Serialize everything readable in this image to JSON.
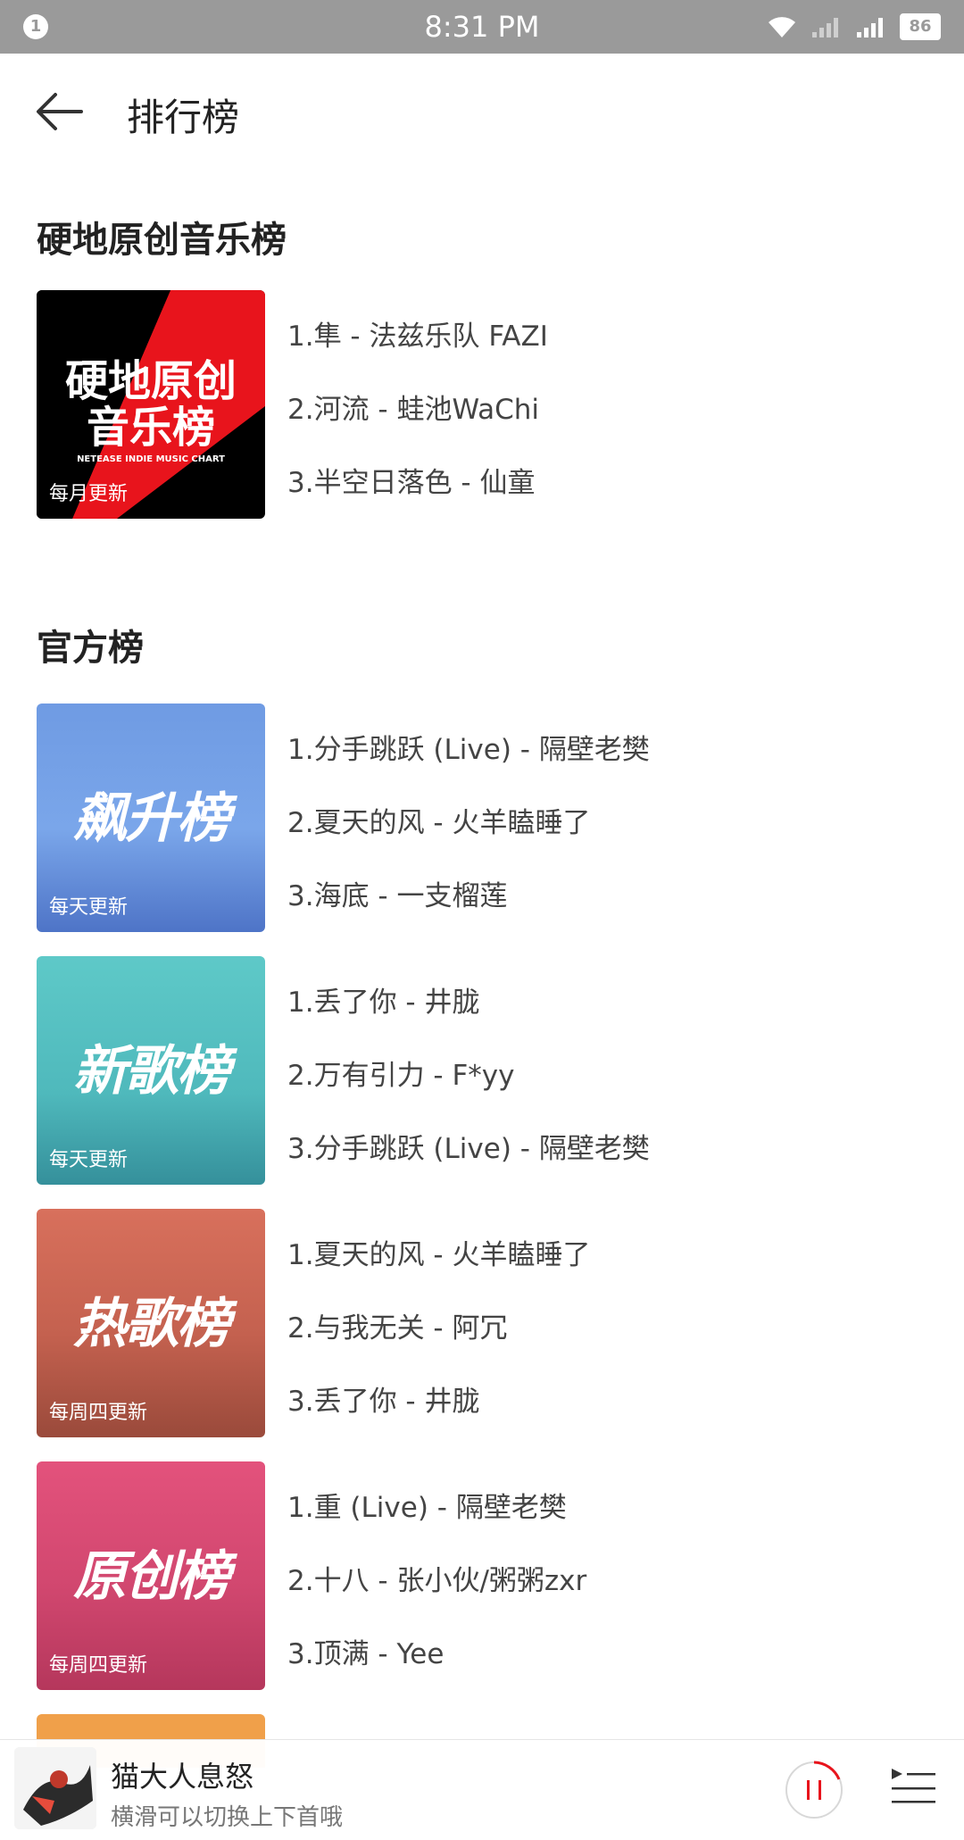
{
  "status_bar": {
    "notification_count": "1",
    "time": "8:31 PM",
    "battery": "86",
    "icons": [
      "wifi-icon",
      "signal-icon",
      "signal-icon-2"
    ]
  },
  "header": {
    "title": "排行榜",
    "back_icon": "arrow-left-icon"
  },
  "sections": [
    {
      "title": "硬地原创音乐榜",
      "charts": [
        {
          "cover_title_line1": "硬地原创",
          "cover_title_line2": "音乐榜",
          "cover_subtitle": "NETEASE INDIE MUSIC CHART",
          "frequency": "每月更新",
          "colors": {
            "bg": "#000000",
            "accent": "#e8141c"
          },
          "tracks": [
            "1.隼 - 法兹乐队 FAZI",
            "2.河流 - 蛙池WaChi",
            "3.半空日落色 - 仙童"
          ]
        }
      ]
    },
    {
      "title": "官方榜",
      "charts": [
        {
          "cover_title": "飙升榜",
          "frequency": "每天更新",
          "colors": {
            "top": "#6f9be3",
            "bottom": "#4e74c7"
          },
          "tracks": [
            "1.分手跳跃 (Live) - 隔壁老樊",
            "2.夏天的风 - 火羊瞌睡了",
            "3.海底 - 一支榴莲"
          ]
        },
        {
          "cover_title": "新歌榜",
          "frequency": "每天更新",
          "colors": {
            "top": "#5ec9c8",
            "bottom": "#35909b"
          },
          "tracks": [
            "1.丢了你 - 井胧",
            "2.万有引力 - F*yy",
            "3.分手跳跃 (Live) - 隔壁老樊"
          ]
        },
        {
          "cover_title": "热歌榜",
          "frequency": "每周四更新",
          "colors": {
            "top": "#d8705c",
            "bottom": "#9a4a3b"
          },
          "tracks": [
            "1.夏天的风 - 火羊瞌睡了",
            "2.与我无关 - 阿冗",
            "3.丢了你 - 井胧"
          ]
        },
        {
          "cover_title": "原创榜",
          "frequency": "每周四更新",
          "colors": {
            "top": "#e3527c",
            "bottom": "#b5375c"
          },
          "tracks": [
            "1.重 (Live) - 隔壁老樊",
            "2.十八 - 张小伙/粥粥zxr",
            "3.顶满 - Yee"
          ]
        }
      ]
    }
  ],
  "player": {
    "song": "猫大人息怒",
    "hint": "横滑可以切换上下首哦",
    "play_icon": "pause-icon",
    "queue_icon": "playlist-icon",
    "accent": "#e8141c"
  }
}
